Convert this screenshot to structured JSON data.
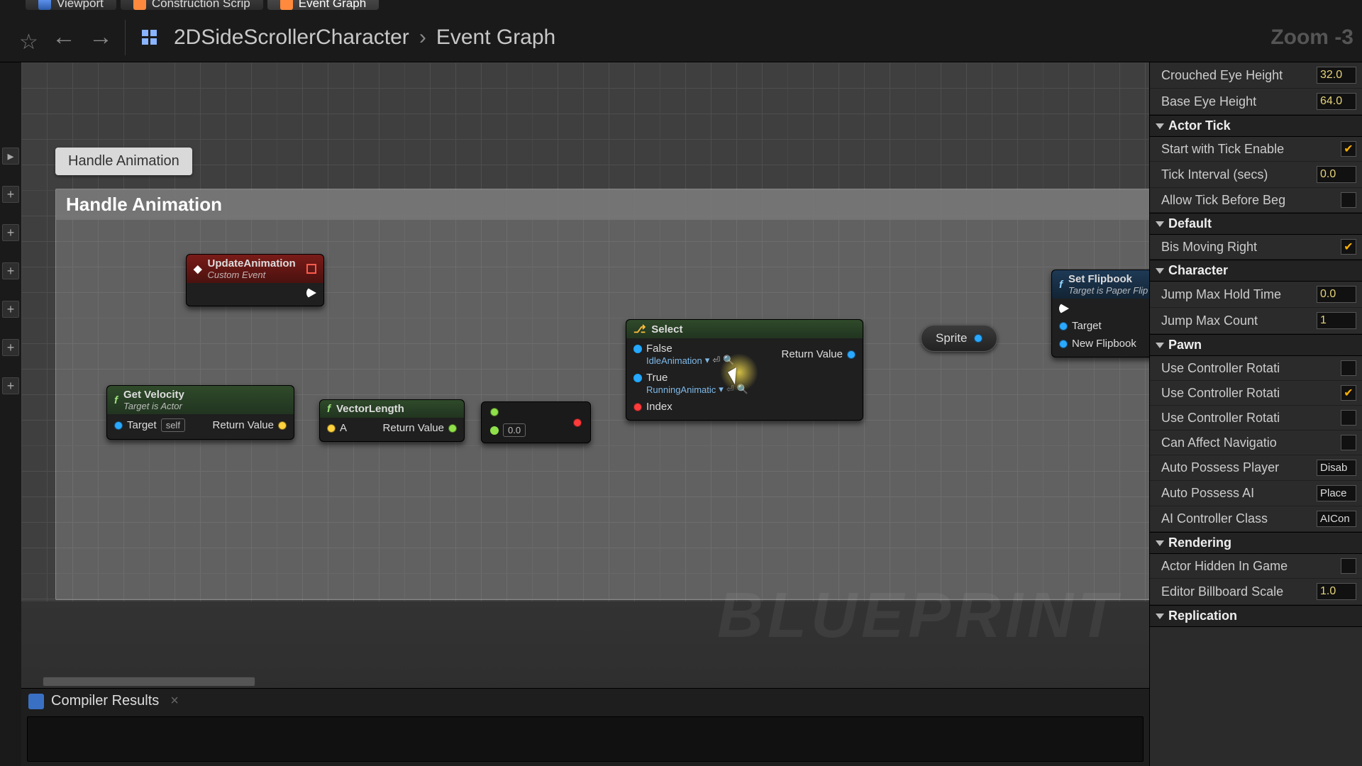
{
  "tabs": {
    "viewport": "Viewport",
    "construction": "Construction Scrip",
    "eventgraph": "Event Graph"
  },
  "breadcrumb": {
    "asset": "2DSideScrollerCharacter",
    "graph": "Event Graph",
    "zoom": "Zoom -3"
  },
  "graph": {
    "chip": "Handle Animation",
    "region_title": "Handle Animation",
    "watermark": "BLUEPRINT",
    "nodes": {
      "update": {
        "title": "UpdateAnimation",
        "subtitle": "Custom Event"
      },
      "getvel": {
        "title": "Get Velocity",
        "subtitle": "Target is Actor",
        "target_label": "Target",
        "target_val": "self",
        "return": "Return Value"
      },
      "veclen": {
        "title": "VectorLength",
        "a": "A",
        "return": "Return Value"
      },
      "cmp": {
        "default": "0.0"
      },
      "select": {
        "title": "Select",
        "false_label": "False",
        "false_val": "IdleAnimation",
        "true_label": "True",
        "true_val": "RunningAnimatic",
        "index": "Index",
        "return": "Return Value"
      },
      "sprite": "Sprite",
      "setfb": {
        "title": "Set Flipbook",
        "subtitle": "Target is Paper Flip",
        "target": "Target",
        "newfb": "New Flipbook"
      }
    }
  },
  "compiler": {
    "title": "Compiler Results"
  },
  "details": {
    "crouched_eye": {
      "label": "Crouched Eye Height",
      "val": "32.0"
    },
    "base_eye": {
      "label": "Base Eye Height",
      "val": "64.0"
    },
    "cat_actor_tick": "Actor Tick",
    "start_tick": {
      "label": "Start with Tick Enable",
      "val": true
    },
    "tick_interval": {
      "label": "Tick Interval (secs)",
      "val": "0.0"
    },
    "allow_tick": {
      "label": "Allow Tick Before Beg",
      "val": false
    },
    "cat_default": "Default",
    "bis_moving": {
      "label": "Bis Moving Right",
      "val": true
    },
    "cat_character": "Character",
    "jump_hold": {
      "label": "Jump Max Hold Time",
      "val": "0.0"
    },
    "jump_count": {
      "label": "Jump Max Count",
      "val": "1"
    },
    "cat_pawn": "Pawn",
    "use_rot1": {
      "label": "Use Controller Rotati",
      "val": false
    },
    "use_rot2": {
      "label": "Use Controller Rotati",
      "val": true
    },
    "use_rot3": {
      "label": "Use Controller Rotati",
      "val": false
    },
    "can_nav": {
      "label": "Can Affect Navigatio",
      "val": false
    },
    "auto_possess_player": {
      "label": "Auto Possess Player",
      "val": "Disab"
    },
    "auto_possess_ai": {
      "label": "Auto Possess AI",
      "val": "Place"
    },
    "ai_class": {
      "label": "AI Controller Class",
      "val": "AICon"
    },
    "cat_rendering": "Rendering",
    "hidden": {
      "label": "Actor Hidden In Game",
      "val": false
    },
    "billboard": {
      "label": "Editor Billboard Scale",
      "val": "1.0"
    },
    "cat_replication": "Replication"
  }
}
